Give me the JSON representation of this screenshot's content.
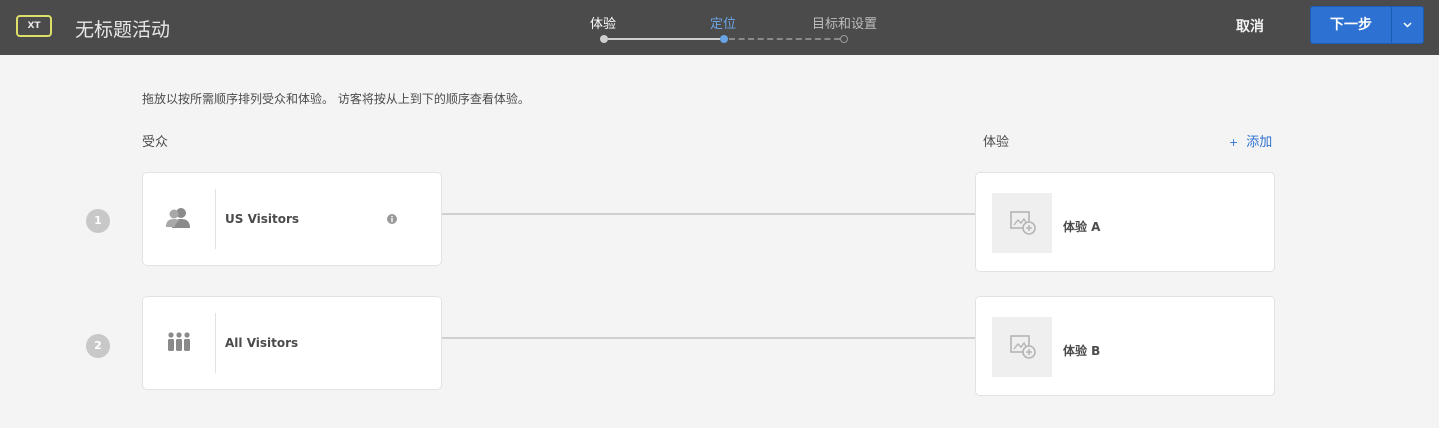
{
  "header": {
    "badge": "XT",
    "title": "无标题活动",
    "steps": [
      {
        "label": "体验",
        "state": "completed"
      },
      {
        "label": "定位",
        "state": "current"
      },
      {
        "label": "目标和设置",
        "state": "upcoming"
      }
    ],
    "cancel_label": "取消",
    "next_label": "下一步"
  },
  "main": {
    "instruction": "拖放以按所需顺序排列受众和体验。 访客将按从上到下的顺序查看体验。",
    "audience_heading": "受众",
    "experience_heading": "体验",
    "add_symbol": "+",
    "add_label": "添加",
    "rows": [
      {
        "number": "1",
        "audience": "US Visitors",
        "audience_icon": "users-icon",
        "has_info": true,
        "experience": "体验 A"
      },
      {
        "number": "2",
        "audience": "All Visitors",
        "audience_icon": "group-icon",
        "has_info": false,
        "experience": "体验 B"
      }
    ]
  },
  "colors": {
    "header_bg": "#4b4b4b",
    "accent": "#2d72d2",
    "current_step": "#6aa4e4",
    "page_bg": "#f4f4f4"
  }
}
